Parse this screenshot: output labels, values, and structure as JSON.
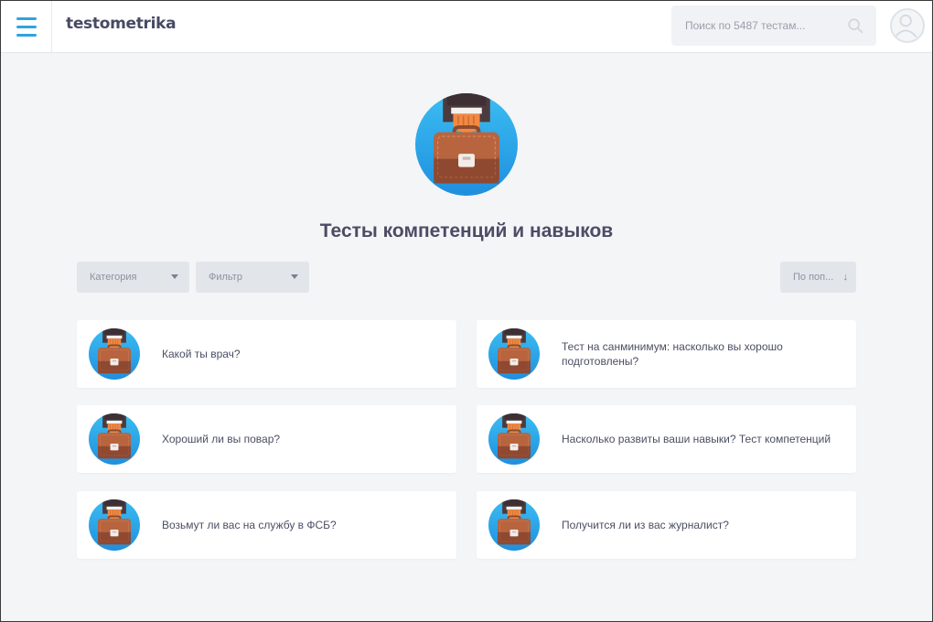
{
  "header": {
    "logo": "testometrika",
    "search_placeholder": "Поиск по 5487 тестам..."
  },
  "page": {
    "title": "Тесты компетенций и навыков"
  },
  "filters": {
    "category": "Категория",
    "filter": "Фильтр",
    "sort": "По поп...",
    "sort_arrow": "↓"
  },
  "tests": [
    {
      "title": "Какой ты врач?"
    },
    {
      "title": "Тест на санминимум: насколько вы хорошо подготовлены?"
    },
    {
      "title": "Хороший ли вы повар?"
    },
    {
      "title": "Насколько развиты ваши навыки? Тест компетенций"
    },
    {
      "title": "Возьмут ли вас на службу в ФСБ?"
    },
    {
      "title": "Получится ли из вас журналист?"
    }
  ],
  "colors": {
    "accent": "#2fa3de",
    "background": "#f4f5f7",
    "title_text": "#4a4d64"
  }
}
